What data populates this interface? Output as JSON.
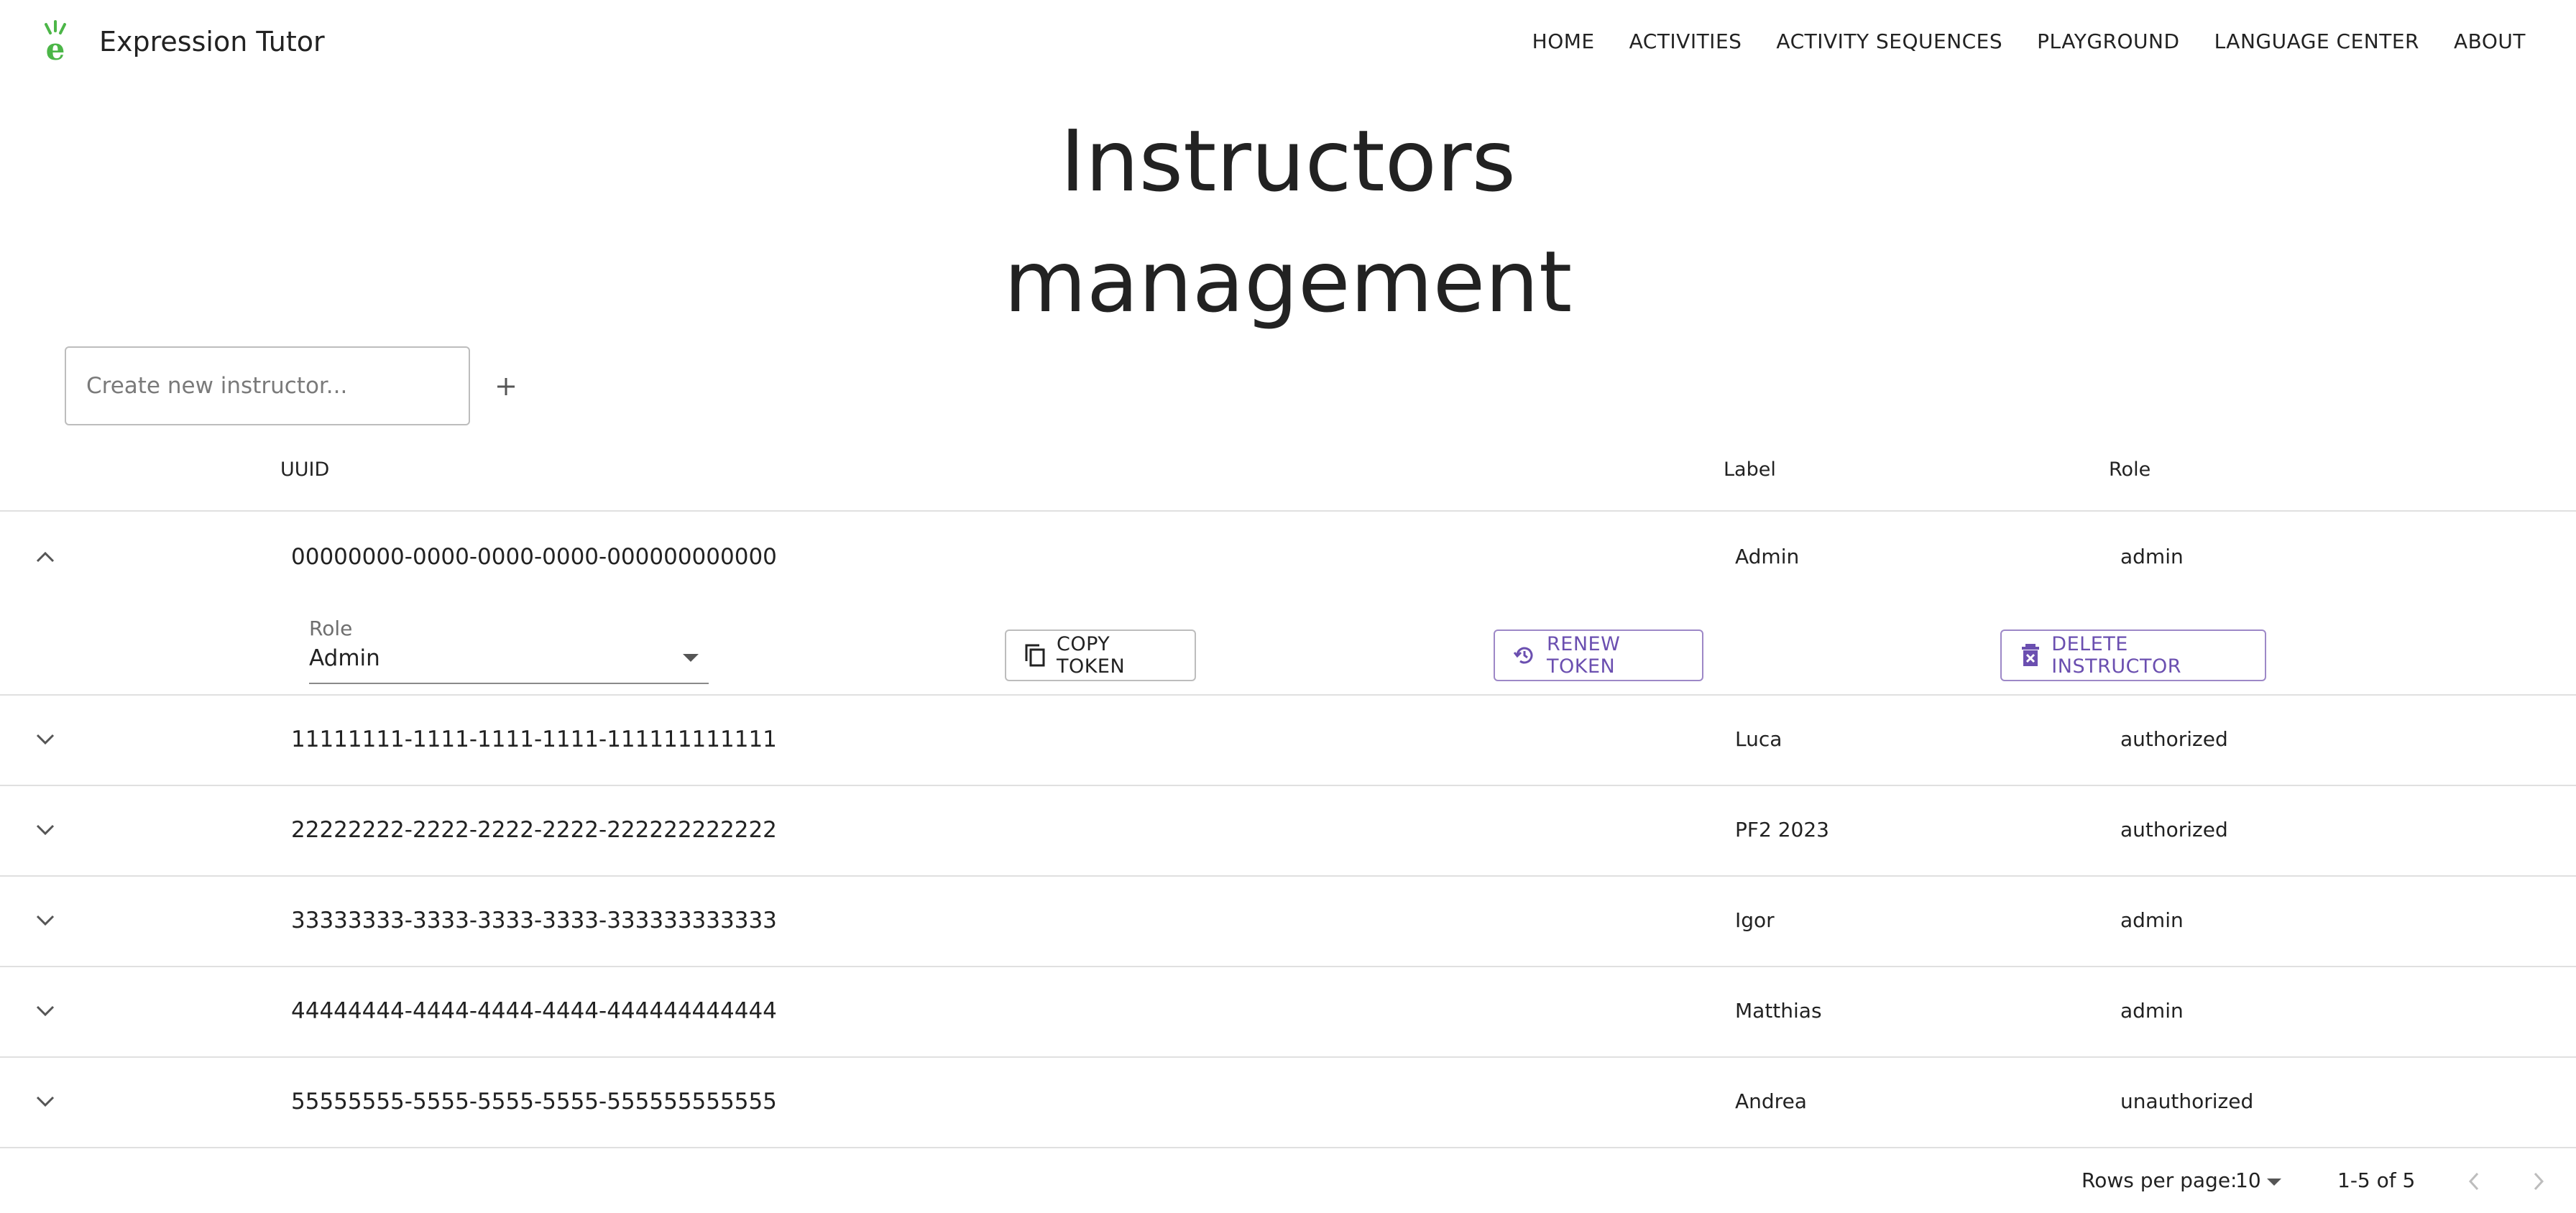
{
  "app": {
    "title": "Expression Tutor",
    "logo_icon": "expression-tutor-logo-icon",
    "brand_color": "#4cb648"
  },
  "nav": {
    "items": [
      {
        "label": "HOME"
      },
      {
        "label": "ACTIVITIES"
      },
      {
        "label": "ACTIVITY SEQUENCES"
      },
      {
        "label": "PLAYGROUND"
      },
      {
        "label": "LANGUAGE CENTER"
      },
      {
        "label": "ABOUT"
      }
    ]
  },
  "page": {
    "title_line1": "Instructors",
    "title_line2": "management"
  },
  "create": {
    "placeholder": "Create new instructor...",
    "value": "",
    "add_icon": "plus-icon"
  },
  "table": {
    "headers": {
      "uuid": "UUID",
      "label": "Label",
      "role": "Role"
    },
    "rows": [
      {
        "uuid": "00000000-0000-0000-0000-000000000000",
        "label": "Admin",
        "role": "admin",
        "expanded": true
      },
      {
        "uuid": "11111111-1111-1111-1111-111111111111",
        "label": "Luca",
        "role": "authorized",
        "expanded": false
      },
      {
        "uuid": "22222222-2222-2222-2222-222222222222",
        "label": "PF2 2023",
        "role": "authorized",
        "expanded": false
      },
      {
        "uuid": "33333333-3333-3333-3333-333333333333",
        "label": "Igor",
        "role": "admin",
        "expanded": false
      },
      {
        "uuid": "44444444-4444-4444-4444-444444444444",
        "label": "Matthias",
        "role": "admin",
        "expanded": false
      },
      {
        "uuid": "55555555-5555-5555-5555-555555555555",
        "label": "Andrea",
        "role": "unauthorized",
        "expanded": false
      }
    ],
    "detail": {
      "role_field_label": "Role",
      "role_field_value": "Admin",
      "copy_token_label": "COPY TOKEN",
      "renew_token_label": "RENEW TOKEN",
      "delete_label": "DELETE INSTRUCTOR",
      "accent_color": "#6b4fb0"
    }
  },
  "pagination": {
    "rows_per_page_label": "Rows per page:",
    "rows_per_page_value": "10",
    "range": "1-5 of 5"
  }
}
